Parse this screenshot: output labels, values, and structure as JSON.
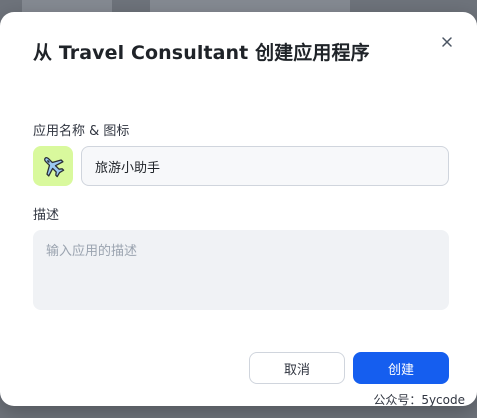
{
  "dialog": {
    "title": "从 Travel Consultant 创建应用程序",
    "close_icon": "close-icon"
  },
  "form": {
    "name_label": "应用名称 & 图标",
    "app_icon": "airplane-icon",
    "app_icon_bg": "#d9f99d",
    "name_value": "旅游小助手",
    "description_label": "描述",
    "description_placeholder": "输入应用的描述",
    "description_value": ""
  },
  "actions": {
    "cancel_label": "取消",
    "create_label": "创建",
    "primary_color": "#155eef"
  },
  "watermark": "公众号：5ycode"
}
